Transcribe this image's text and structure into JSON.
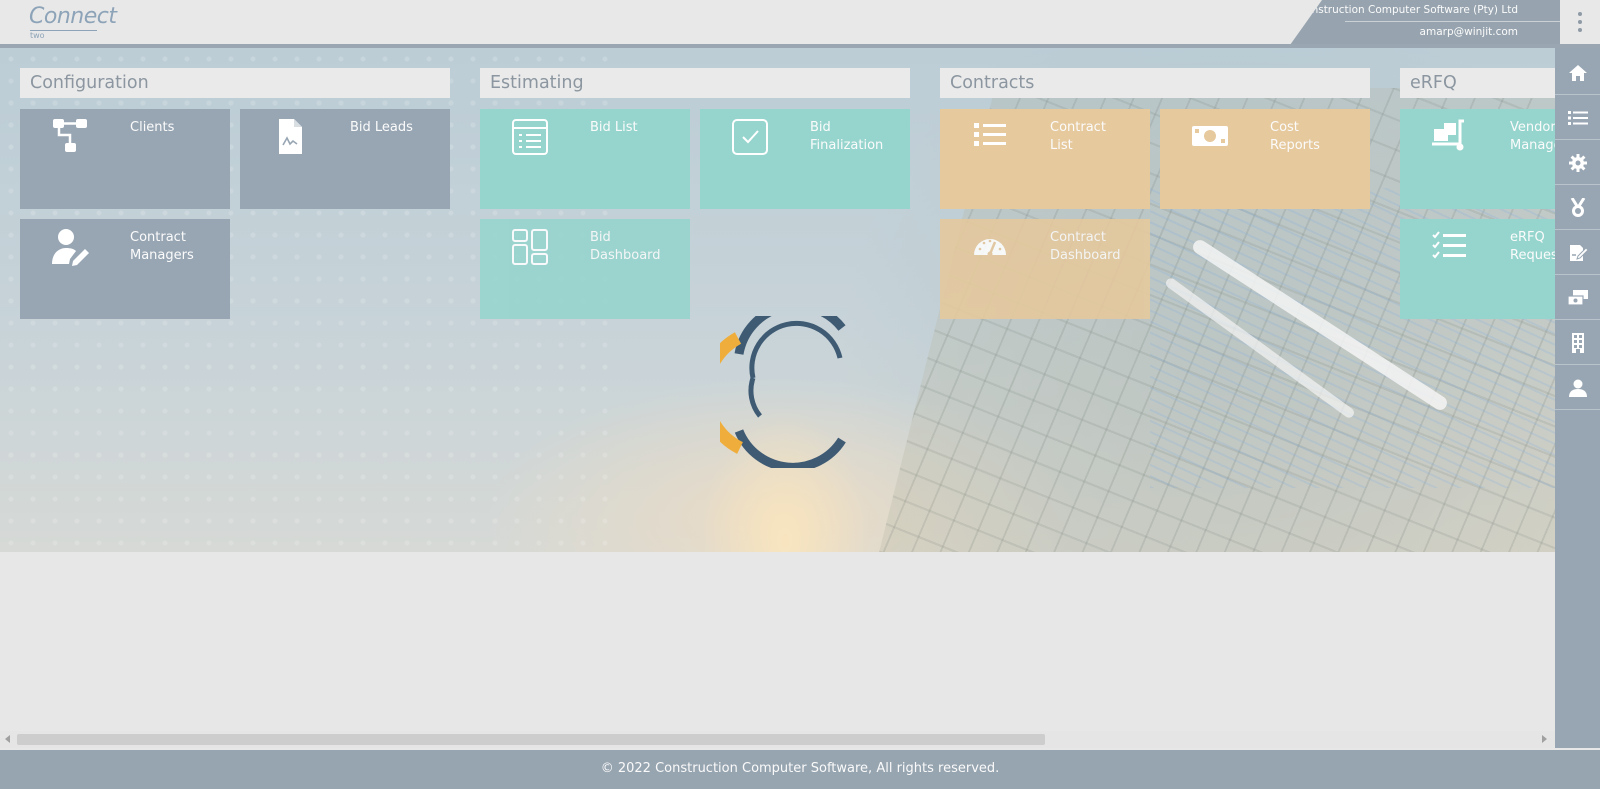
{
  "header": {
    "logo_text": "Connect",
    "logo_sub": "two",
    "company": "Construction Computer Software (Pty) Ltd",
    "user": "amarp@winjit.com"
  },
  "sections": {
    "configuration": {
      "title": "Configuration",
      "tiles": [
        {
          "label": "Clients",
          "icon": "sitemap-icon"
        },
        {
          "label": "Bid Leads",
          "icon": "signed-document-icon"
        },
        {
          "label": "Contract\nManagers",
          "icon": "user-edit-icon"
        }
      ]
    },
    "estimating": {
      "title": "Estimating",
      "tiles": [
        {
          "label": "Bid List",
          "icon": "list-document-icon"
        },
        {
          "label": "Bid\nFinalization",
          "icon": "check-square-icon"
        },
        {
          "label": "Bid\nDashboard",
          "icon": "dashboard-layout-icon"
        }
      ]
    },
    "contracts": {
      "title": "Contracts",
      "tiles": [
        {
          "label": "Contract\nList",
          "icon": "list-icon"
        },
        {
          "label": "Cost\nReports",
          "icon": "money-icon"
        },
        {
          "label": "Contract\nDashboard",
          "icon": "speedometer-icon"
        }
      ]
    },
    "erfq": {
      "title": "eRFQ",
      "tiles": [
        {
          "label": "Vendor\nManage",
          "icon": "dolly-icon"
        },
        {
          "label": "eRFQ\nReques",
          "icon": "checklist-icon"
        }
      ]
    }
  },
  "sidebar": {
    "items": [
      "home-icon",
      "list-icon",
      "gear-icon",
      "medal-icon",
      "signature-icon",
      "money-transfer-icon",
      "building-icon",
      "user-icon"
    ]
  },
  "footer": {
    "copyright": "© 2022 Construction Computer Software, All rights reserved."
  },
  "colors": {
    "configuration_tile": "#98a6b4",
    "estimating_tile": "#96d5ce",
    "contracts_tile": "#e6c99d",
    "spinner_blue": "#3f5b74",
    "spinner_orange": "#efae3c"
  }
}
